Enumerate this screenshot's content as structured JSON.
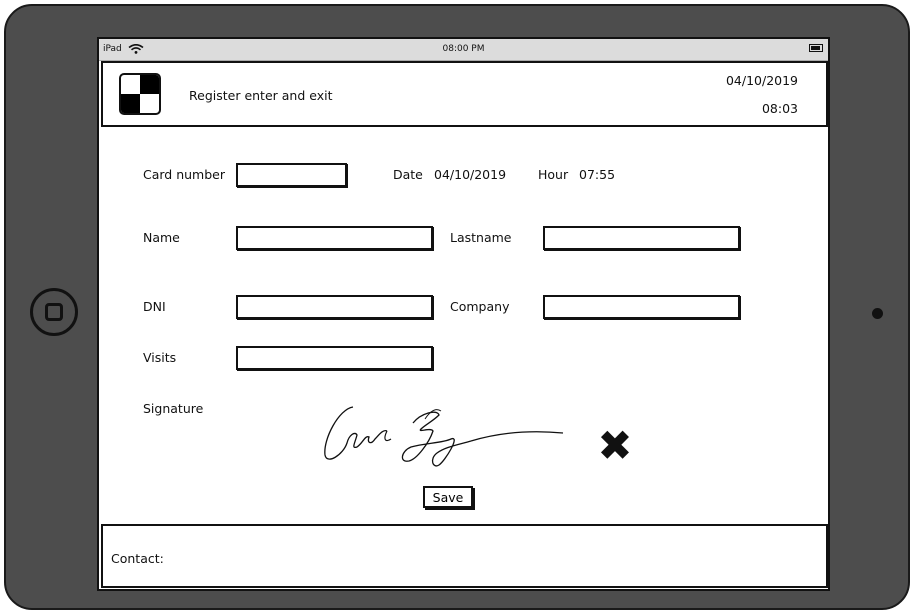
{
  "device": {
    "name": "iPad",
    "clock": "08:00 PM",
    "icons": [
      "wifi-icon",
      "battery-icon"
    ]
  },
  "header": {
    "title": "Register enter and exit",
    "date": "04/10/2019",
    "time": "08:03",
    "logo_icon": "checkerboard-logo"
  },
  "form": {
    "card_number": {
      "label": "Card number",
      "value": ""
    },
    "date": {
      "label": "Date",
      "value": "04/10/2019"
    },
    "hour": {
      "label": "Hour",
      "value": "07:55"
    },
    "name": {
      "label": "Name",
      "value": ""
    },
    "lastname": {
      "label": "Lastname",
      "value": ""
    },
    "dni": {
      "label": "DNI",
      "value": ""
    },
    "company": {
      "label": "Company",
      "value": ""
    },
    "visits": {
      "label": "Visits",
      "value": ""
    },
    "signature": {
      "label": "Signature"
    },
    "clear_icon": "close-x-icon",
    "save_label": "Save"
  },
  "footer": {
    "contact_label": "Contact:"
  },
  "colors": {
    "device_frame": "#4d4d4d",
    "status_bar": "#dcdcdc",
    "ink": "#111111"
  }
}
